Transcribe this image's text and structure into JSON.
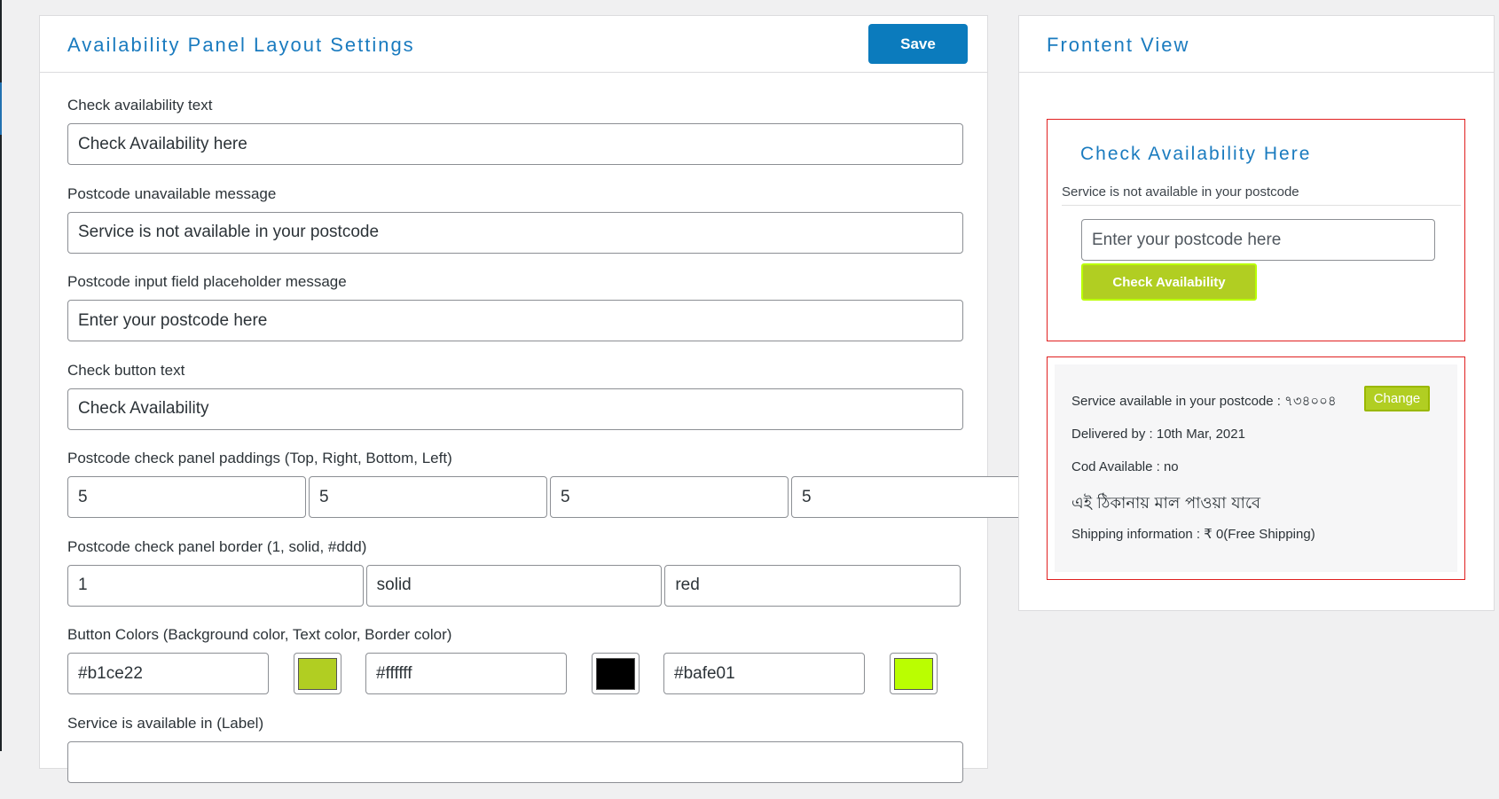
{
  "settings": {
    "title": "Availability Panel Layout Settings",
    "save_label": "Save",
    "fields": {
      "check_text": {
        "label": "Check availability text",
        "value": "Check Availability here"
      },
      "unavailable_msg": {
        "label": "Postcode unavailable message",
        "value": "Service is not available in your postcode"
      },
      "placeholder_msg": {
        "label": "Postcode input field placeholder message",
        "value": "Enter your postcode here"
      },
      "button_text": {
        "label": "Check button text",
        "value": "Check Availability"
      },
      "paddings": {
        "label": "Postcode check panel paddings (Top, Right, Bottom, Left)",
        "top": "5",
        "right": "5",
        "bottom": "5",
        "left": "5"
      },
      "border": {
        "label": "Postcode check panel border (1, solid, #ddd)",
        "width": "1",
        "style": "solid",
        "color": "red"
      },
      "button_colors": {
        "label": "Button Colors (Background color, Text color, Border color)",
        "background": "#b1ce22",
        "text": "#ffffff",
        "border": "#bafe01"
      },
      "available_label": {
        "label": "Service is available in (Label)",
        "value": ""
      }
    }
  },
  "preview": {
    "title": "Frontent View",
    "check_title": "Check Availability Here",
    "unavailable_msg": "Service is not available in your postcode",
    "input_placeholder": "Enter your postcode here",
    "check_button": "Check Availability",
    "result": {
      "available_text": "Service available in your postcode : ৭৩৪০০৪",
      "change_label": "Change",
      "delivered_by": "Delivered by : 10th Mar, 2021",
      "cod": "Cod Available : no",
      "bengali_note": "এই ঠিকানায় মাল পাওয়া যাবে",
      "shipping": "Shipping information : ₹ 0(Free Shipping)"
    }
  },
  "colors": {
    "accent_blue": "#1a7bbf",
    "save_blue": "#0b7bbd",
    "button_bg": "#b1ce22",
    "button_border": "#bafe01",
    "panel_border": "#e02020",
    "swatch_text": "#000000"
  }
}
